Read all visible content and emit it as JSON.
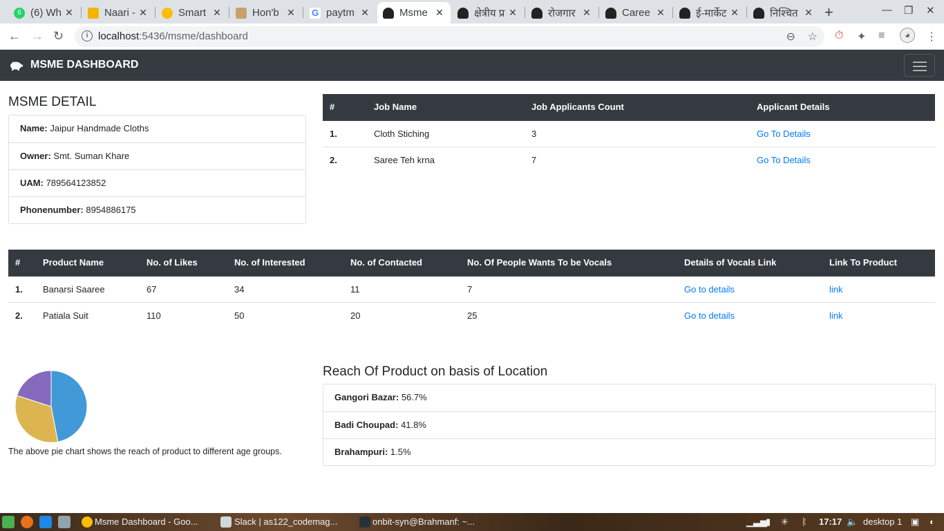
{
  "browser": {
    "tabs": [
      {
        "title": "(6) Wh",
        "badge": "6"
      },
      {
        "title": "Naari -"
      },
      {
        "title": "Smart"
      },
      {
        "title": "Hon'b"
      },
      {
        "title": "paytm"
      },
      {
        "title": "Msme"
      },
      {
        "title": "क्षेत्रीय प्र"
      },
      {
        "title": "रोजगार"
      },
      {
        "title": "Caree"
      },
      {
        "title": "ई-मार्केट"
      },
      {
        "title": "निश्चित"
      }
    ],
    "url_host": "localhost",
    "url_rest": ":5436/msme/dashboard"
  },
  "navbar": {
    "brand": "MSME DASHBOARD"
  },
  "msme_detail": {
    "title": "MSME DETAIL",
    "items": [
      {
        "label": "Name:",
        "value": "Jaipur Handmade Cloths"
      },
      {
        "label": "Owner:",
        "value": "Smt. Suman Khare"
      },
      {
        "label": "UAM:",
        "value": "789564123852"
      },
      {
        "label": "Phonenumber:",
        "value": "8954886175"
      }
    ]
  },
  "jobs": {
    "headers": [
      "#",
      "Job Name",
      "Job Applicants Count",
      "Applicant Details"
    ],
    "rows": [
      {
        "num": "1.",
        "name": "Cloth Stiching",
        "count": "3",
        "link": "Go To Details"
      },
      {
        "num": "2.",
        "name": "Saree Teh krna",
        "count": "7",
        "link": "Go To Details"
      }
    ]
  },
  "products": {
    "headers": [
      "#",
      "Product Name",
      "No. of Likes",
      "No. of Interested",
      "No. of Contacted",
      "No. Of People Wants To be Vocals",
      "Details of Vocals Link",
      "Link To Product"
    ],
    "rows": [
      {
        "num": "1.",
        "name": "Banarsi Saaree",
        "likes": "67",
        "interested": "34",
        "contacted": "11",
        "vocals": "7",
        "details": "Go to details",
        "link": "link"
      },
      {
        "num": "2.",
        "name": "Patiala Suit",
        "likes": "110",
        "interested": "50",
        "contacted": "20",
        "vocals": "25",
        "details": "Go to details",
        "link": "link"
      }
    ]
  },
  "chart_data": {
    "type": "pie",
    "values": [
      47,
      33,
      20
    ],
    "colors": [
      "#4299d8",
      "#dcb551",
      "#8469bc"
    ],
    "caption": "The above pie chart shows the reach of product to different age groups."
  },
  "reach": {
    "title": "Reach Of Product on basis of Location",
    "items": [
      {
        "label": "Gangori Bazar:",
        "value": "56.7%"
      },
      {
        "label": "Badi Choupad:",
        "value": "41.8%"
      },
      {
        "label": "Brahampuri:",
        "value": "1.5%"
      }
    ]
  },
  "taskbar": {
    "items": [
      "Msme Dashboard - Goo...",
      "Slack | as122_codemag...",
      "onbit-syn@Brahmanf: ~..."
    ],
    "clock": "17:17",
    "desktop": "desktop 1"
  }
}
